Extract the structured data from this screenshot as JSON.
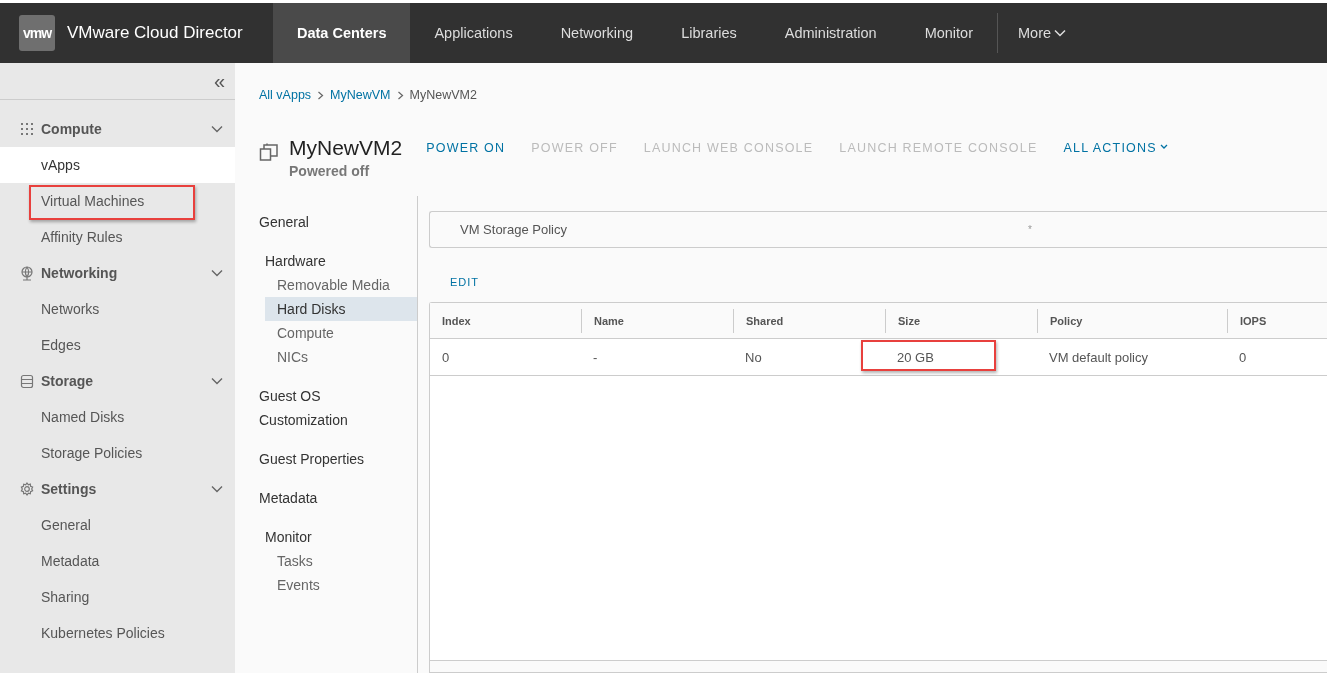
{
  "header": {
    "logo": "vmw",
    "title": "VMware Cloud Director",
    "tabs": [
      {
        "label": "Data Centers",
        "selected": true
      },
      {
        "label": "Applications",
        "selected": false
      },
      {
        "label": "Networking",
        "selected": false
      },
      {
        "label": "Libraries",
        "selected": false
      },
      {
        "label": "Administration",
        "selected": false
      },
      {
        "label": "Monitor",
        "selected": false
      }
    ],
    "more": "More"
  },
  "sidebar": {
    "collapse": "«",
    "groups": [
      {
        "label": "Compute",
        "kind": "compute",
        "expanded": true,
        "items": [
          {
            "label": "vApps",
            "selected": true,
            "highlighted": false
          },
          {
            "label": "Virtual Machines",
            "selected": false,
            "highlighted": true
          },
          {
            "label": "Affinity Rules",
            "selected": false,
            "highlighted": false
          }
        ]
      },
      {
        "label": "Networking",
        "kind": "networking",
        "expanded": true,
        "items": [
          {
            "label": "Networks",
            "selected": false,
            "highlighted": false
          },
          {
            "label": "Edges",
            "selected": false,
            "highlighted": false
          }
        ]
      },
      {
        "label": "Storage",
        "kind": "storage",
        "expanded": true,
        "items": [
          {
            "label": "Named Disks",
            "selected": false,
            "highlighted": false
          },
          {
            "label": "Storage Policies",
            "selected": false,
            "highlighted": false
          }
        ]
      },
      {
        "label": "Settings",
        "kind": "settings",
        "expanded": true,
        "items": [
          {
            "label": "General",
            "selected": false,
            "highlighted": false
          },
          {
            "label": "Metadata",
            "selected": false,
            "highlighted": false
          },
          {
            "label": "Sharing",
            "selected": false,
            "highlighted": false
          },
          {
            "label": "Kubernetes Policies",
            "selected": false,
            "highlighted": false
          }
        ]
      }
    ]
  },
  "breadcrumbs": [
    {
      "label": "All vApps",
      "link": true
    },
    {
      "label": "MyNewVM",
      "link": true
    },
    {
      "label": "MyNewVM2",
      "link": false
    }
  ],
  "vm": {
    "name": "MyNewVM2",
    "status": "Powered off"
  },
  "actions": [
    {
      "label": "POWER ON",
      "disabled": false,
      "dropdown": false
    },
    {
      "label": "POWER OFF",
      "disabled": true,
      "dropdown": false
    },
    {
      "label": "LAUNCH WEB CONSOLE",
      "disabled": true,
      "dropdown": false
    },
    {
      "label": "LAUNCH REMOTE CONSOLE",
      "disabled": true,
      "dropdown": false
    },
    {
      "label": "ALL ACTIONS",
      "disabled": false,
      "dropdown": true
    }
  ],
  "subnav": [
    {
      "label": "General",
      "selected": false
    },
    {
      "label": "Hardware",
      "selected": false,
      "children": [
        {
          "label": "Removable Media",
          "selected": false
        },
        {
          "label": "Hard Disks",
          "selected": true
        },
        {
          "label": "Compute",
          "selected": false
        },
        {
          "label": "NICs",
          "selected": false
        }
      ]
    },
    {
      "label": "Guest OS Customization",
      "selected": false
    },
    {
      "label": "Guest Properties",
      "selected": false
    },
    {
      "label": "Metadata",
      "selected": false
    },
    {
      "label": "Monitor",
      "selected": false,
      "children": [
        {
          "label": "Tasks",
          "selected": false
        },
        {
          "label": "Events",
          "selected": false
        }
      ]
    }
  ],
  "storage_policy": {
    "label": "VM Storage Policy",
    "value": "*"
  },
  "edit_button": "EDIT",
  "table": {
    "columns": [
      "Index",
      "Name",
      "Shared",
      "Size",
      "Policy",
      "IOPS"
    ],
    "rows": [
      [
        {
          "text": "0",
          "highlighted": false
        },
        {
          "text": "-",
          "highlighted": false
        },
        {
          "text": "No",
          "highlighted": false
        },
        {
          "text": "20 GB",
          "highlighted": true
        },
        {
          "text": "VM default policy",
          "highlighted": false
        },
        {
          "text": "0",
          "highlighted": false
        }
      ]
    ]
  }
}
